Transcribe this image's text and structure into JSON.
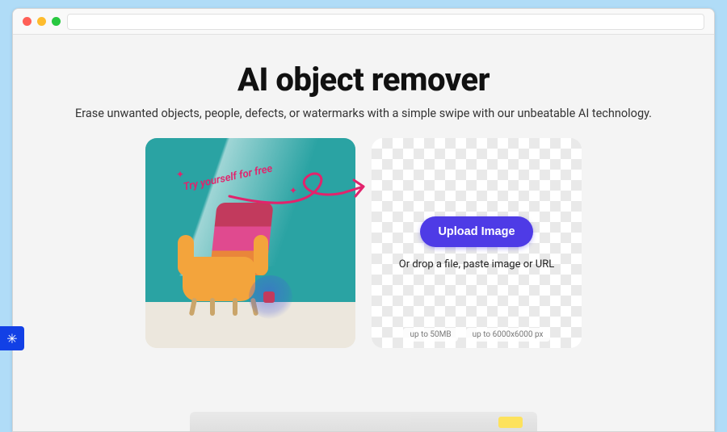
{
  "hero": {
    "title": "AI object remover",
    "subtitle": "Erase unwanted objects, people, defects, or watermarks with a simple swipe with our unbeatable AI technology."
  },
  "callout": {
    "text": "Try yourself for free"
  },
  "upload": {
    "button": "Upload Image",
    "hint": "Or drop a file, paste image or URL",
    "limit_size": "up to 50MB",
    "limit_res": "up to 6000x6000 px"
  }
}
